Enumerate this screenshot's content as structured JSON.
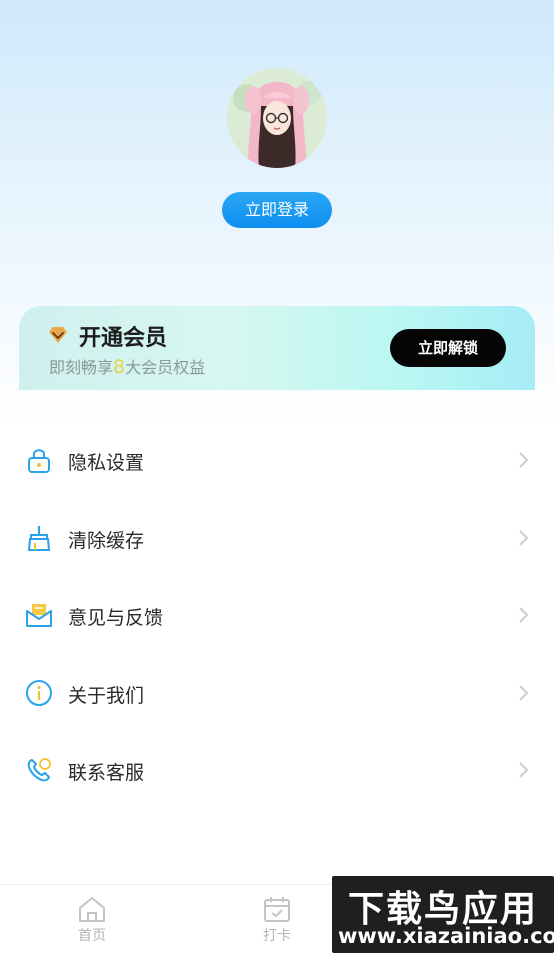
{
  "profile": {
    "login_label": "立即登录"
  },
  "vip": {
    "title": "开通会员",
    "subtitle_prefix": "即刻畅享",
    "subtitle_number": "8",
    "subtitle_suffix": "大会员权益",
    "unlock_label": "立即解锁"
  },
  "menu": {
    "items": [
      {
        "label": "隐私设置",
        "icon": "lock-icon"
      },
      {
        "label": "清除缓存",
        "icon": "broom-icon"
      },
      {
        "label": "意见与反馈",
        "icon": "envelope-icon"
      },
      {
        "label": "关于我们",
        "icon": "info-icon"
      },
      {
        "label": "联系客服",
        "icon": "phone-icon"
      }
    ]
  },
  "tabbar": {
    "tabs": [
      {
        "label": "首页",
        "icon": "home-icon"
      },
      {
        "label": "打卡",
        "icon": "calendar-check-icon"
      }
    ]
  },
  "watermark": {
    "title": "下载鸟应用",
    "url": "www.xiazainiao.com"
  },
  "colors": {
    "accent": "#1a9af2",
    "vip_number": "#e7d34f",
    "icon_blue": "#2aa3e8"
  }
}
